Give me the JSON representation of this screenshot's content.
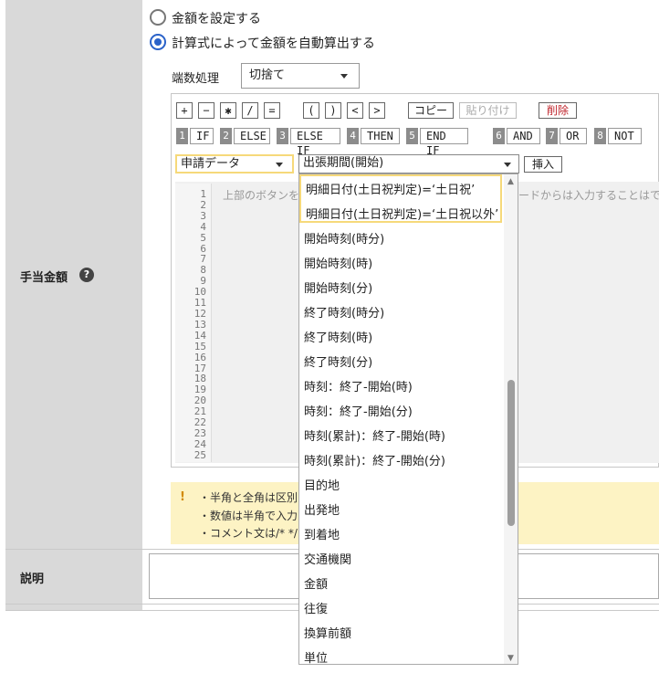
{
  "form": {
    "amount_label": "手当金額",
    "help_icon": "?",
    "desc_label": "説明"
  },
  "radio": {
    "fixed_label": "金額を設定する",
    "formula_label": "計算式によって金額を自動算出する",
    "selected": "formula"
  },
  "rounding": {
    "label": "端数処理",
    "value": "切捨て"
  },
  "toolbar": {
    "ops": [
      "+",
      "−",
      "✱",
      "/",
      "="
    ],
    "parens": [
      "(",
      ")",
      "<",
      ">"
    ],
    "copy_label": "コピー",
    "paste_label": "貼り付け",
    "delete_label": "削除"
  },
  "keywords": [
    {
      "num": "1",
      "text": "IF"
    },
    {
      "num": "2",
      "text": "ELSE"
    },
    {
      "num": "3",
      "text": "ELSE IF"
    },
    {
      "num": "4",
      "text": "THEN"
    },
    {
      "num": "5",
      "text": "END IF"
    },
    {
      "num": "6",
      "text": "AND"
    },
    {
      "num": "7",
      "text": "OR"
    },
    {
      "num": "8",
      "text": "NOT"
    }
  ],
  "selectors": {
    "source_value": "申請データ",
    "field_value": "出張期間(開始)",
    "insert_label": "挿入"
  },
  "editor": {
    "placeholder_left": "上部のボタンを",
    "placeholder_right": "ードからは入力することはで",
    "line_numbers": [
      "1",
      "2",
      "3",
      "4",
      "5",
      "6",
      "7",
      "8",
      "9",
      "10",
      "11",
      "12",
      "13",
      "14",
      "15",
      "16",
      "17",
      "18",
      "19",
      "20",
      "21",
      "22",
      "23",
      "24",
      "25"
    ]
  },
  "dropdown": {
    "highlighted": [
      "明細日付(土日祝判定)=‘土日祝’",
      "明細日付(土日祝判定)=‘土日祝以外’"
    ],
    "options": [
      "開始時刻(時分)",
      "開始時刻(時)",
      "開始時刻(分)",
      "終了時刻(時分)",
      "終了時刻(時)",
      "終了時刻(分)",
      "時刻：終了-開始(時)",
      "時刻：終了-開始(分)",
      "時刻(累計)：終了-開始(時)",
      "時刻(累計)：終了-開始(分)",
      "目的地",
      "出発地",
      "到着地",
      "交通機関",
      "金額",
      "往復",
      "換算前額",
      "単位"
    ]
  },
  "notice": {
    "icon": "!",
    "lines": [
      "・半角と全角は区別さ",
      "・数値は半角で入力し",
      "・コメント文は/* */"
    ]
  }
}
